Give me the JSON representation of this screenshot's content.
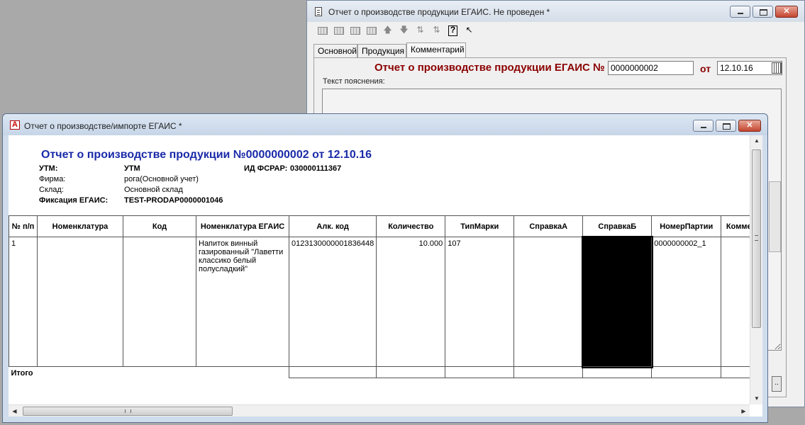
{
  "back_window": {
    "title": "Отчет о производстве продукции ЕГАИС. Не проведен *",
    "tabs": [
      "Основной",
      "Продукция",
      "Комментарий"
    ],
    "active_tab": "Комментарий",
    "header_label": "Отчет о производстве продукции ЕГАИС №",
    "number_value": "0000000002",
    "from_label": "от",
    "date_value": "12.10.16",
    "explanation_label": "Текст пояснения:",
    "button_label": ".."
  },
  "front_window": {
    "title": "Отчет о производстве/импорте ЕГАИС  *",
    "report": {
      "title": "Отчет о производстве продукции №0000000002 от 12.10.16",
      "utm_label": "УТМ:",
      "utm_value": "УТМ",
      "fsrar_label": "ИД ФСРАР:",
      "fsrar_value": "030000111367",
      "firm_label": "Фирма:",
      "firm_value": "рога(Основной учет)",
      "warehouse_label": "Склад:",
      "warehouse_value": "Основной склад",
      "fixation_label": "Фиксация ЕГАИС:",
      "fixation_value": "TEST-PRODAP0000001046"
    },
    "table": {
      "columns": [
        "№ п/п",
        "Номенклатура",
        "Код",
        "Номенклатура ЕГАИС",
        "Алк. код",
        "Количество",
        "ТипМарки",
        "СправкаА",
        "СправкаБ",
        "НомерПартии",
        "Комме"
      ],
      "rows": [
        {
          "n": "1",
          "nomenclature": "",
          "code": "",
          "egais_nomenclature": "Напиток винный газированный \"Лаветти классико белый полусладкий\"",
          "alc_code": "0123130000001836448",
          "quantity": "10.000",
          "mark_type": "107",
          "cert_a": "",
          "cert_b": "",
          "batch": "0000000002_1",
          "comment": ""
        }
      ],
      "total_label": "Итого"
    }
  }
}
